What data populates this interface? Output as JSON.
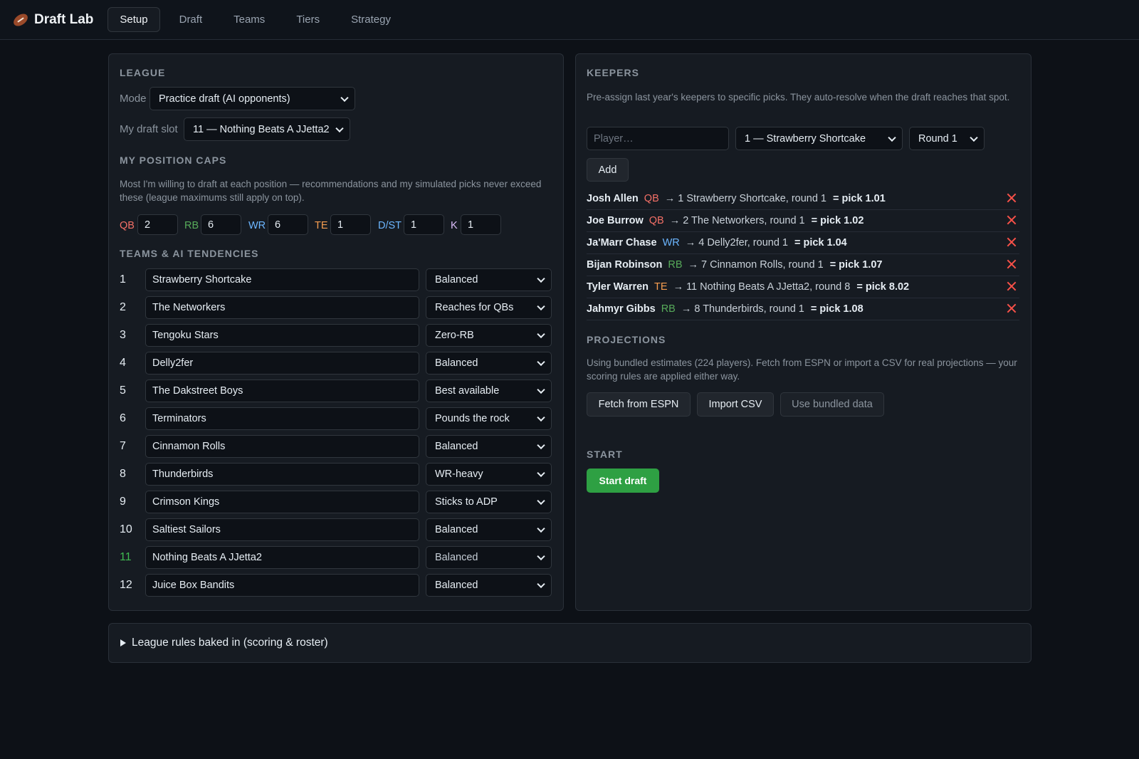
{
  "app": {
    "title": "Draft Lab"
  },
  "nav": {
    "tabs": [
      "Setup",
      "Draft",
      "Teams",
      "Tiers",
      "Strategy"
    ],
    "active": "Setup"
  },
  "league": {
    "section_title": "LEAGUE",
    "mode_label": "Mode",
    "mode_value": "Practice draft (AI opponents)",
    "slot_label": "My draft slot",
    "slot_value": "11 — Nothing Beats A JJetta2"
  },
  "caps": {
    "section_title": "MY POSITION CAPS",
    "description": "Most I'm willing to draft at each position — recommendations and my simulated picks never exceed these (league maximums still apply on top).",
    "items": [
      {
        "pos": "QB",
        "value": "2"
      },
      {
        "pos": "RB",
        "value": "6"
      },
      {
        "pos": "WR",
        "value": "6"
      },
      {
        "pos": "TE",
        "value": "1"
      },
      {
        "pos": "D/ST",
        "value": "1"
      },
      {
        "pos": "K",
        "value": "1"
      }
    ]
  },
  "teams": {
    "section_title": "TEAMS & AI TENDENCIES",
    "rows": [
      {
        "num": "1",
        "name": "Strawberry Shortcake",
        "tendency": "Balanced"
      },
      {
        "num": "2",
        "name": "The Networkers",
        "tendency": "Reaches for QBs"
      },
      {
        "num": "3",
        "name": "Tengoku Stars",
        "tendency": "Zero-RB"
      },
      {
        "num": "4",
        "name": "Delly2fer",
        "tendency": "Balanced"
      },
      {
        "num": "5",
        "name": "The Dakstreet Boys",
        "tendency": "Best available"
      },
      {
        "num": "6",
        "name": "Terminators",
        "tendency": "Pounds the rock"
      },
      {
        "num": "7",
        "name": "Cinnamon Rolls",
        "tendency": "Balanced"
      },
      {
        "num": "8",
        "name": "Thunderbirds",
        "tendency": "WR-heavy"
      },
      {
        "num": "9",
        "name": "Crimson Kings",
        "tendency": "Sticks to ADP"
      },
      {
        "num": "10",
        "name": "Saltiest Sailors",
        "tendency": "Balanced"
      },
      {
        "num": "11",
        "name": "Nothing Beats A JJetta2",
        "tendency": "Balanced"
      },
      {
        "num": "12",
        "name": "Juice Box Bandits",
        "tendency": "Balanced"
      }
    ]
  },
  "keepers": {
    "section_title": "KEEPERS",
    "description": "Pre-assign last year's keepers to specific picks. They auto-resolve when the draft reaches that spot.",
    "player_placeholder": "Player…",
    "team_select": "1 — Strawberry Shortcake",
    "round_select": "Round 1",
    "add_label": "Add",
    "rows": [
      {
        "name": "Josh Allen",
        "pos": "QB",
        "arrow": "→",
        "text": "1 Strawberry Shortcake, round 1",
        "pick": "= pick 1.01"
      },
      {
        "name": "Joe Burrow",
        "pos": "QB",
        "arrow": "→",
        "text": "2 The Networkers, round 1",
        "pick": "= pick 1.02"
      },
      {
        "name": "Ja'Marr Chase",
        "pos": "WR",
        "arrow": "→",
        "text": "4 Delly2fer, round 1",
        "pick": "= pick 1.04"
      },
      {
        "name": "Bijan Robinson",
        "pos": "RB",
        "arrow": "→",
        "text": "7 Cinnamon Rolls, round 1",
        "pick": "= pick 1.07"
      },
      {
        "name": "Tyler Warren",
        "pos": "TE",
        "arrow": "→",
        "text": "11 Nothing Beats A JJetta2, round 8",
        "pick": "= pick 8.02"
      },
      {
        "name": "Jahmyr Gibbs",
        "pos": "RB",
        "arrow": "→",
        "text": "8 Thunderbirds, round 1",
        "pick": "= pick 1.08"
      }
    ]
  },
  "projections": {
    "section_title": "PROJECTIONS",
    "description": "Using bundled estimates (224 players). Fetch from ESPN or import a CSV for real projections — your scoring rules are applied either way.",
    "fetch_label": "Fetch from ESPN",
    "import_label": "Import CSV",
    "bundled_label": "Use bundled data"
  },
  "start": {
    "section_title": "START",
    "button_label": "Start draft"
  },
  "rules": {
    "summary": "League rules baked in (scoring & roster)"
  },
  "colors": {
    "qb": "#f47067",
    "rb": "#57ab5a",
    "wr": "#6cb6ff",
    "te": "#f69d50",
    "k": "#dcbdfb",
    "accent_green": "#2ea043",
    "remove_red": "#f85149"
  }
}
